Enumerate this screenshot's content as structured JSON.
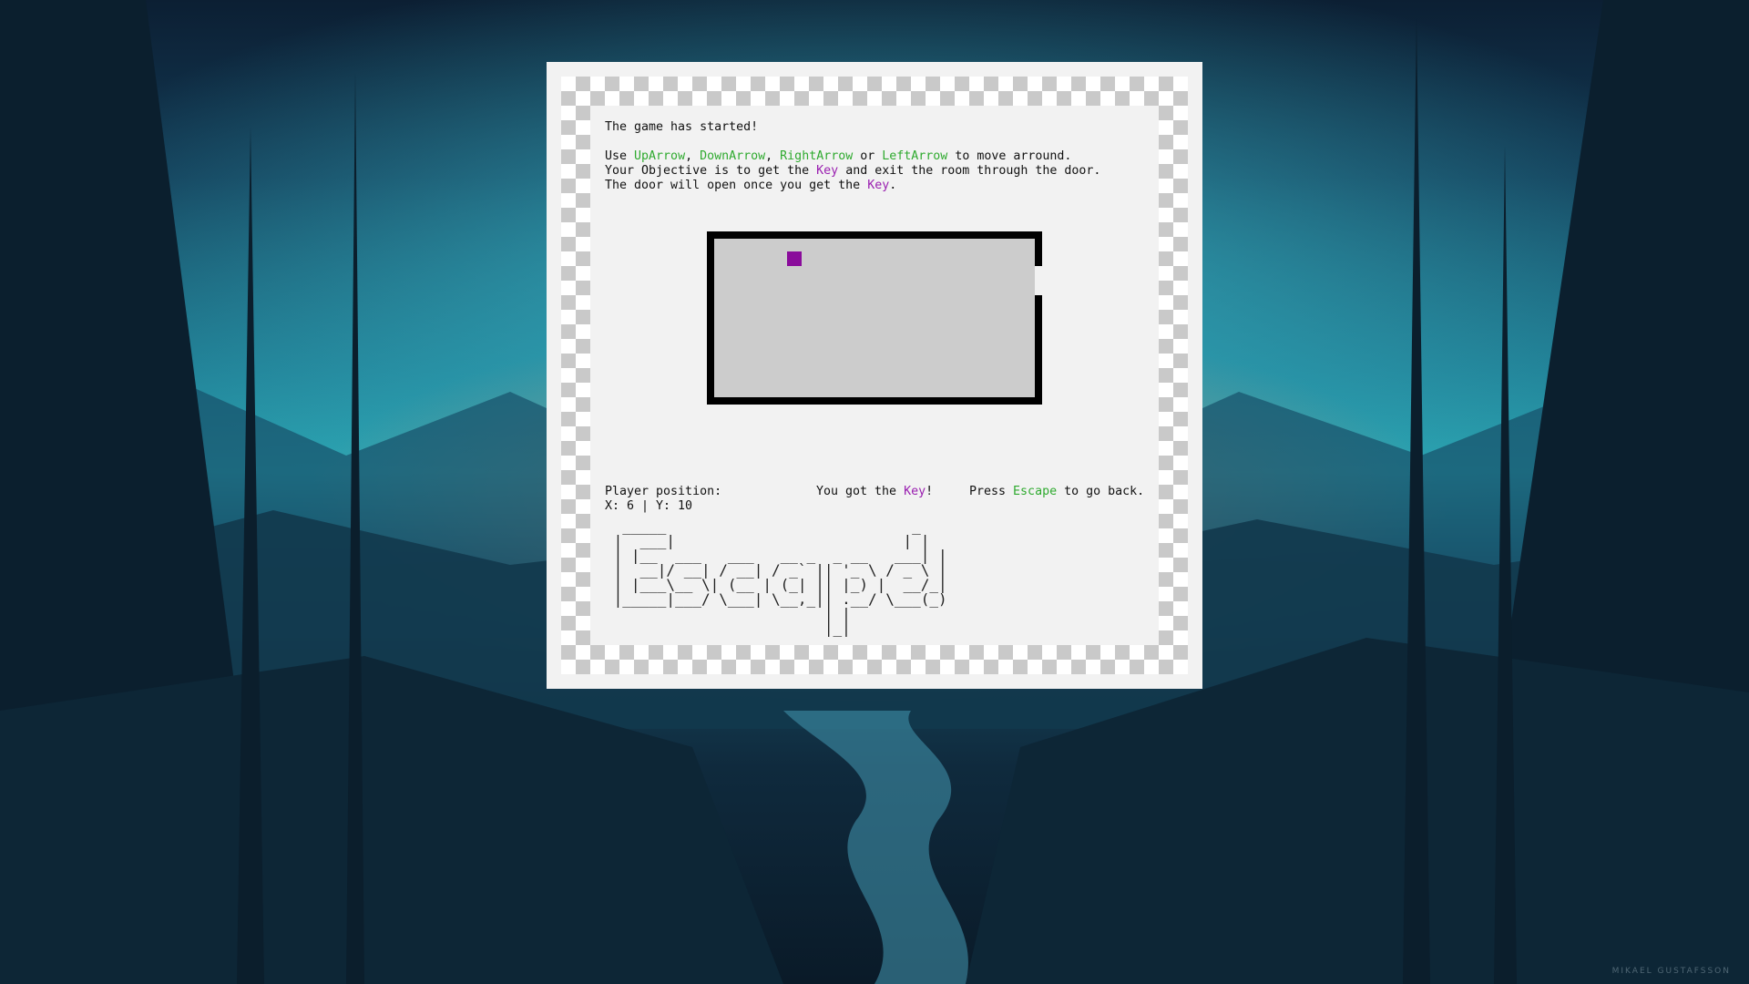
{
  "intro": {
    "started": "The game has started!",
    "instructions": {
      "use_label": "Use ",
      "up": "UpArrow",
      "sep1": ", ",
      "down": "DownArrow",
      "sep2": ", ",
      "right": "RightArrow",
      "or_label": " or ",
      "left": "LeftArrow",
      "move_tail": " to move arround."
    },
    "objective": {
      "prefix": "Your Objective is to get the ",
      "key_word": "Key",
      "suffix": " and exit the room through the door."
    },
    "door_note": {
      "prefix": "The door will open once you get the ",
      "key_word": "Key",
      "suffix": "."
    }
  },
  "status": {
    "position_label": "Player position:",
    "coords": "X: 6 | Y: 10",
    "got_key_prefix": "You got the ",
    "got_key_word": "Key",
    "got_key_suffix": "!",
    "press_label": "Press ",
    "escape_key": "Escape",
    "go_back": " to go back."
  },
  "banner_ascii": "  _____                            _ \n |  ___|                          | |\n | |__  ___   ___   __ _  _ __   ___| |\n |  __|/ __| / __| / _` || '_ \\ / _ \\ |\n | |___\\__ \\| (__ | (_| || |_) |  __/_|\n |_____|___/ \\___| \\__,_|| .__/ \\___(_)\n                         | |          \n                         |_|          ",
  "banner_text": "Escape!",
  "credit": "MIKAEL GUSTAFSSON",
  "colors": {
    "key": "#8a0c9b",
    "control_keys": "#2faa2f",
    "room_wall": "#000000",
    "room_floor": "#cccccc"
  }
}
